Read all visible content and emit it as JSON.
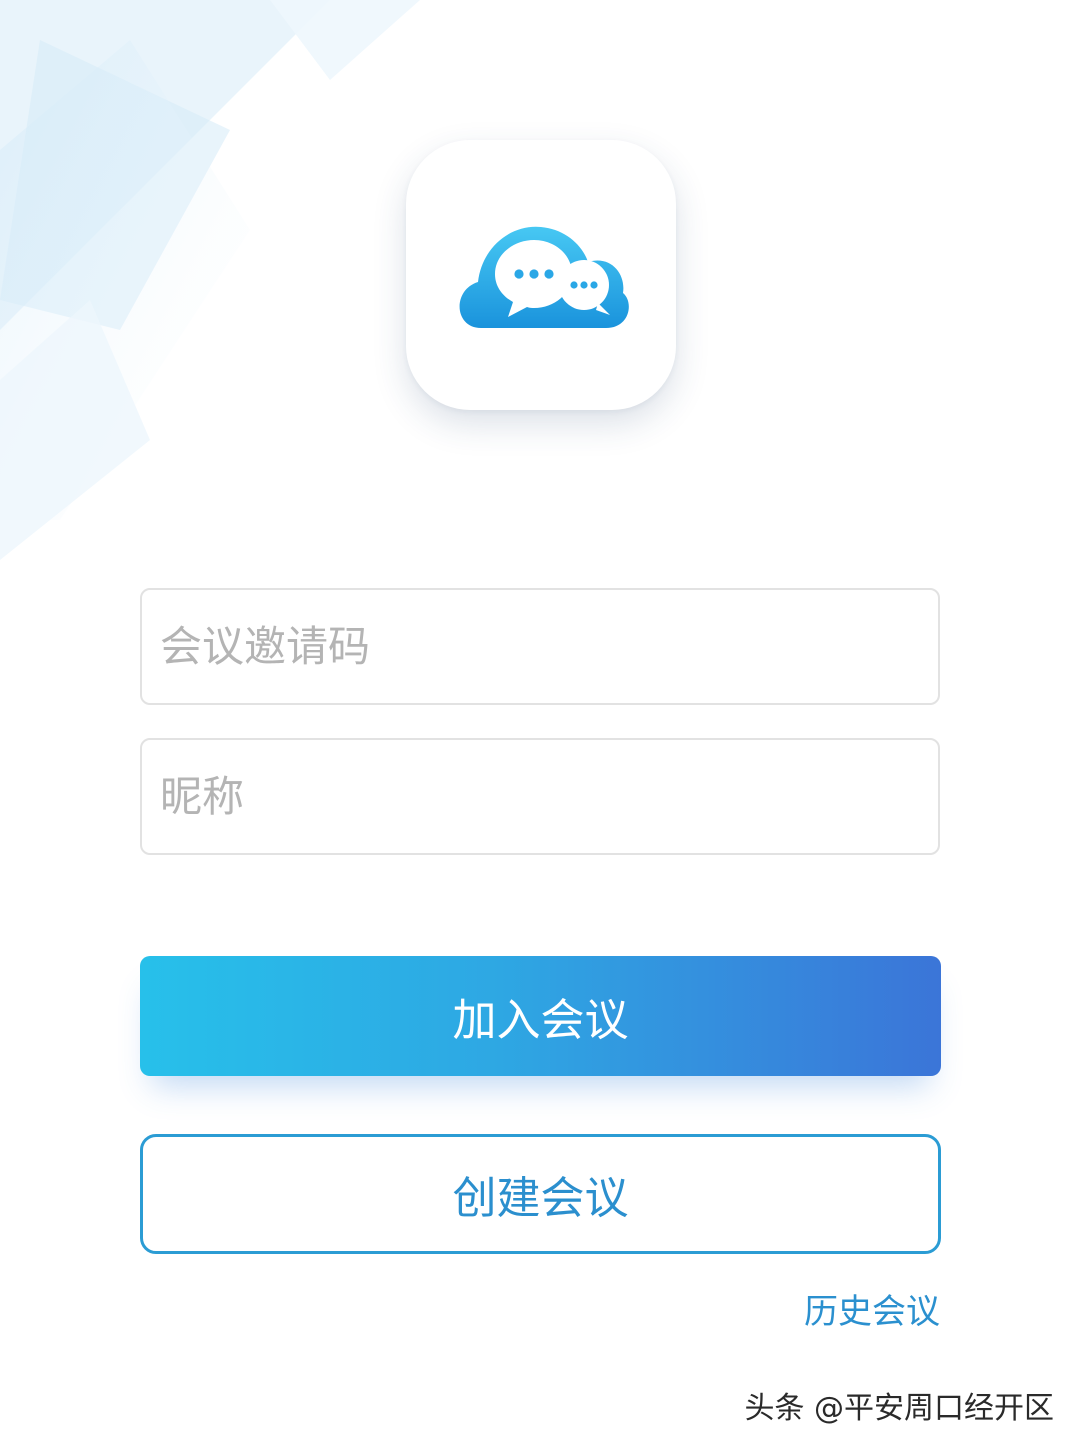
{
  "form": {
    "invite_code_placeholder": "会议邀请码",
    "invite_code_value": "",
    "nickname_placeholder": "昵称",
    "nickname_value": ""
  },
  "actions": {
    "join_label": "加入会议",
    "create_label": "创建会议",
    "history_label": "历史会议"
  },
  "watermark": {
    "text": "头条 @平安周口经开区"
  },
  "app_icon": {
    "icon": "cloud-chat-icon"
  },
  "colors": {
    "accent": "#2b9cd4",
    "gradient_start": "#27c0ea",
    "gradient_end": "#3b75d8",
    "placeholder": "#b4b4b4",
    "field_border": "#e2e2e2"
  }
}
